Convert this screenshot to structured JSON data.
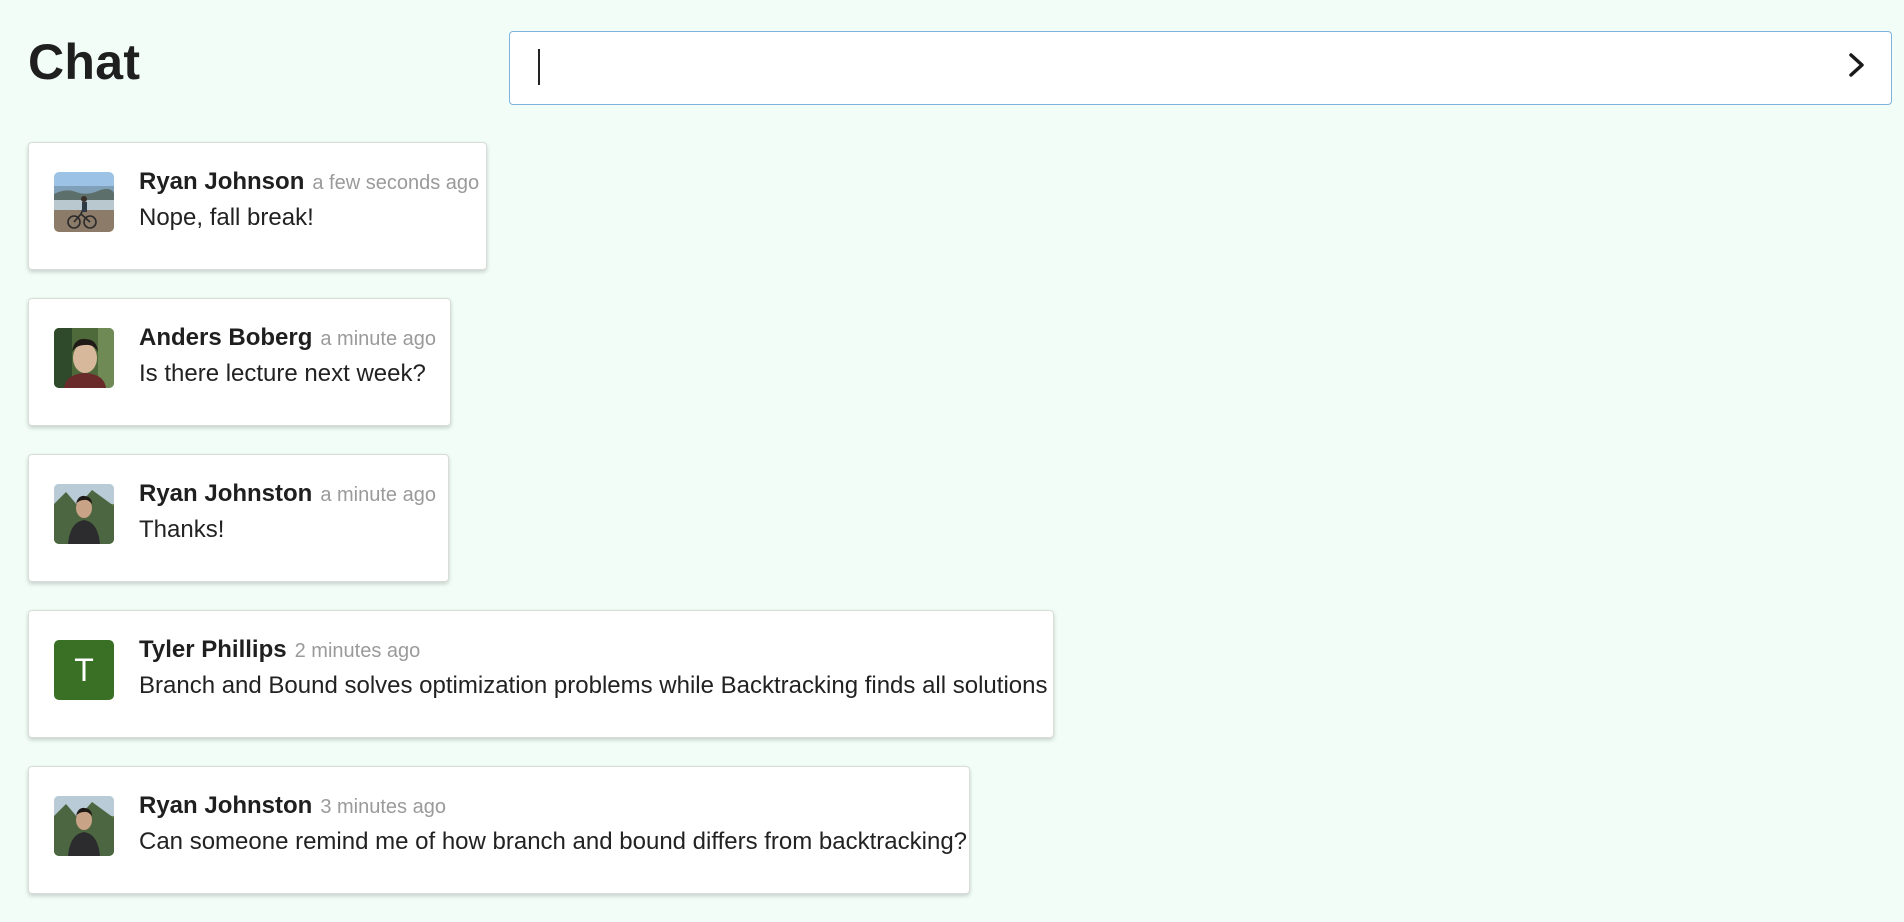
{
  "header": {
    "title": "Chat"
  },
  "composer": {
    "value": "",
    "placeholder": "",
    "send_icon": "chevron-right-icon"
  },
  "colors": {
    "background": "#f2fdf7",
    "input_border": "#7fb3de",
    "initial_avatar": "#3a7025",
    "timestamp": "#9a9a9a"
  },
  "messages": [
    {
      "author": "Ryan Johnson",
      "time": "a few seconds ago",
      "text": "Nope, fall break!",
      "avatar": "photo-beach-bike"
    },
    {
      "author": "Anders Boberg",
      "time": "a minute ago",
      "text": "Is there lecture next week?",
      "avatar": "photo-portrait"
    },
    {
      "author": "Ryan Johnston",
      "time": "a minute ago",
      "text": "Thanks!",
      "avatar": "photo-outdoor-portrait"
    },
    {
      "author": "Tyler Phillips",
      "time": "2 minutes ago",
      "text": "Branch and Bound solves optimization problems while Backtracking finds all solutions",
      "avatar": "initial",
      "avatar_initial": "T"
    },
    {
      "author": "Ryan Johnston",
      "time": "3 minutes ago",
      "text": "Can someone remind me of how branch and bound differs from backtracking?",
      "avatar": "photo-outdoor-portrait"
    }
  ]
}
